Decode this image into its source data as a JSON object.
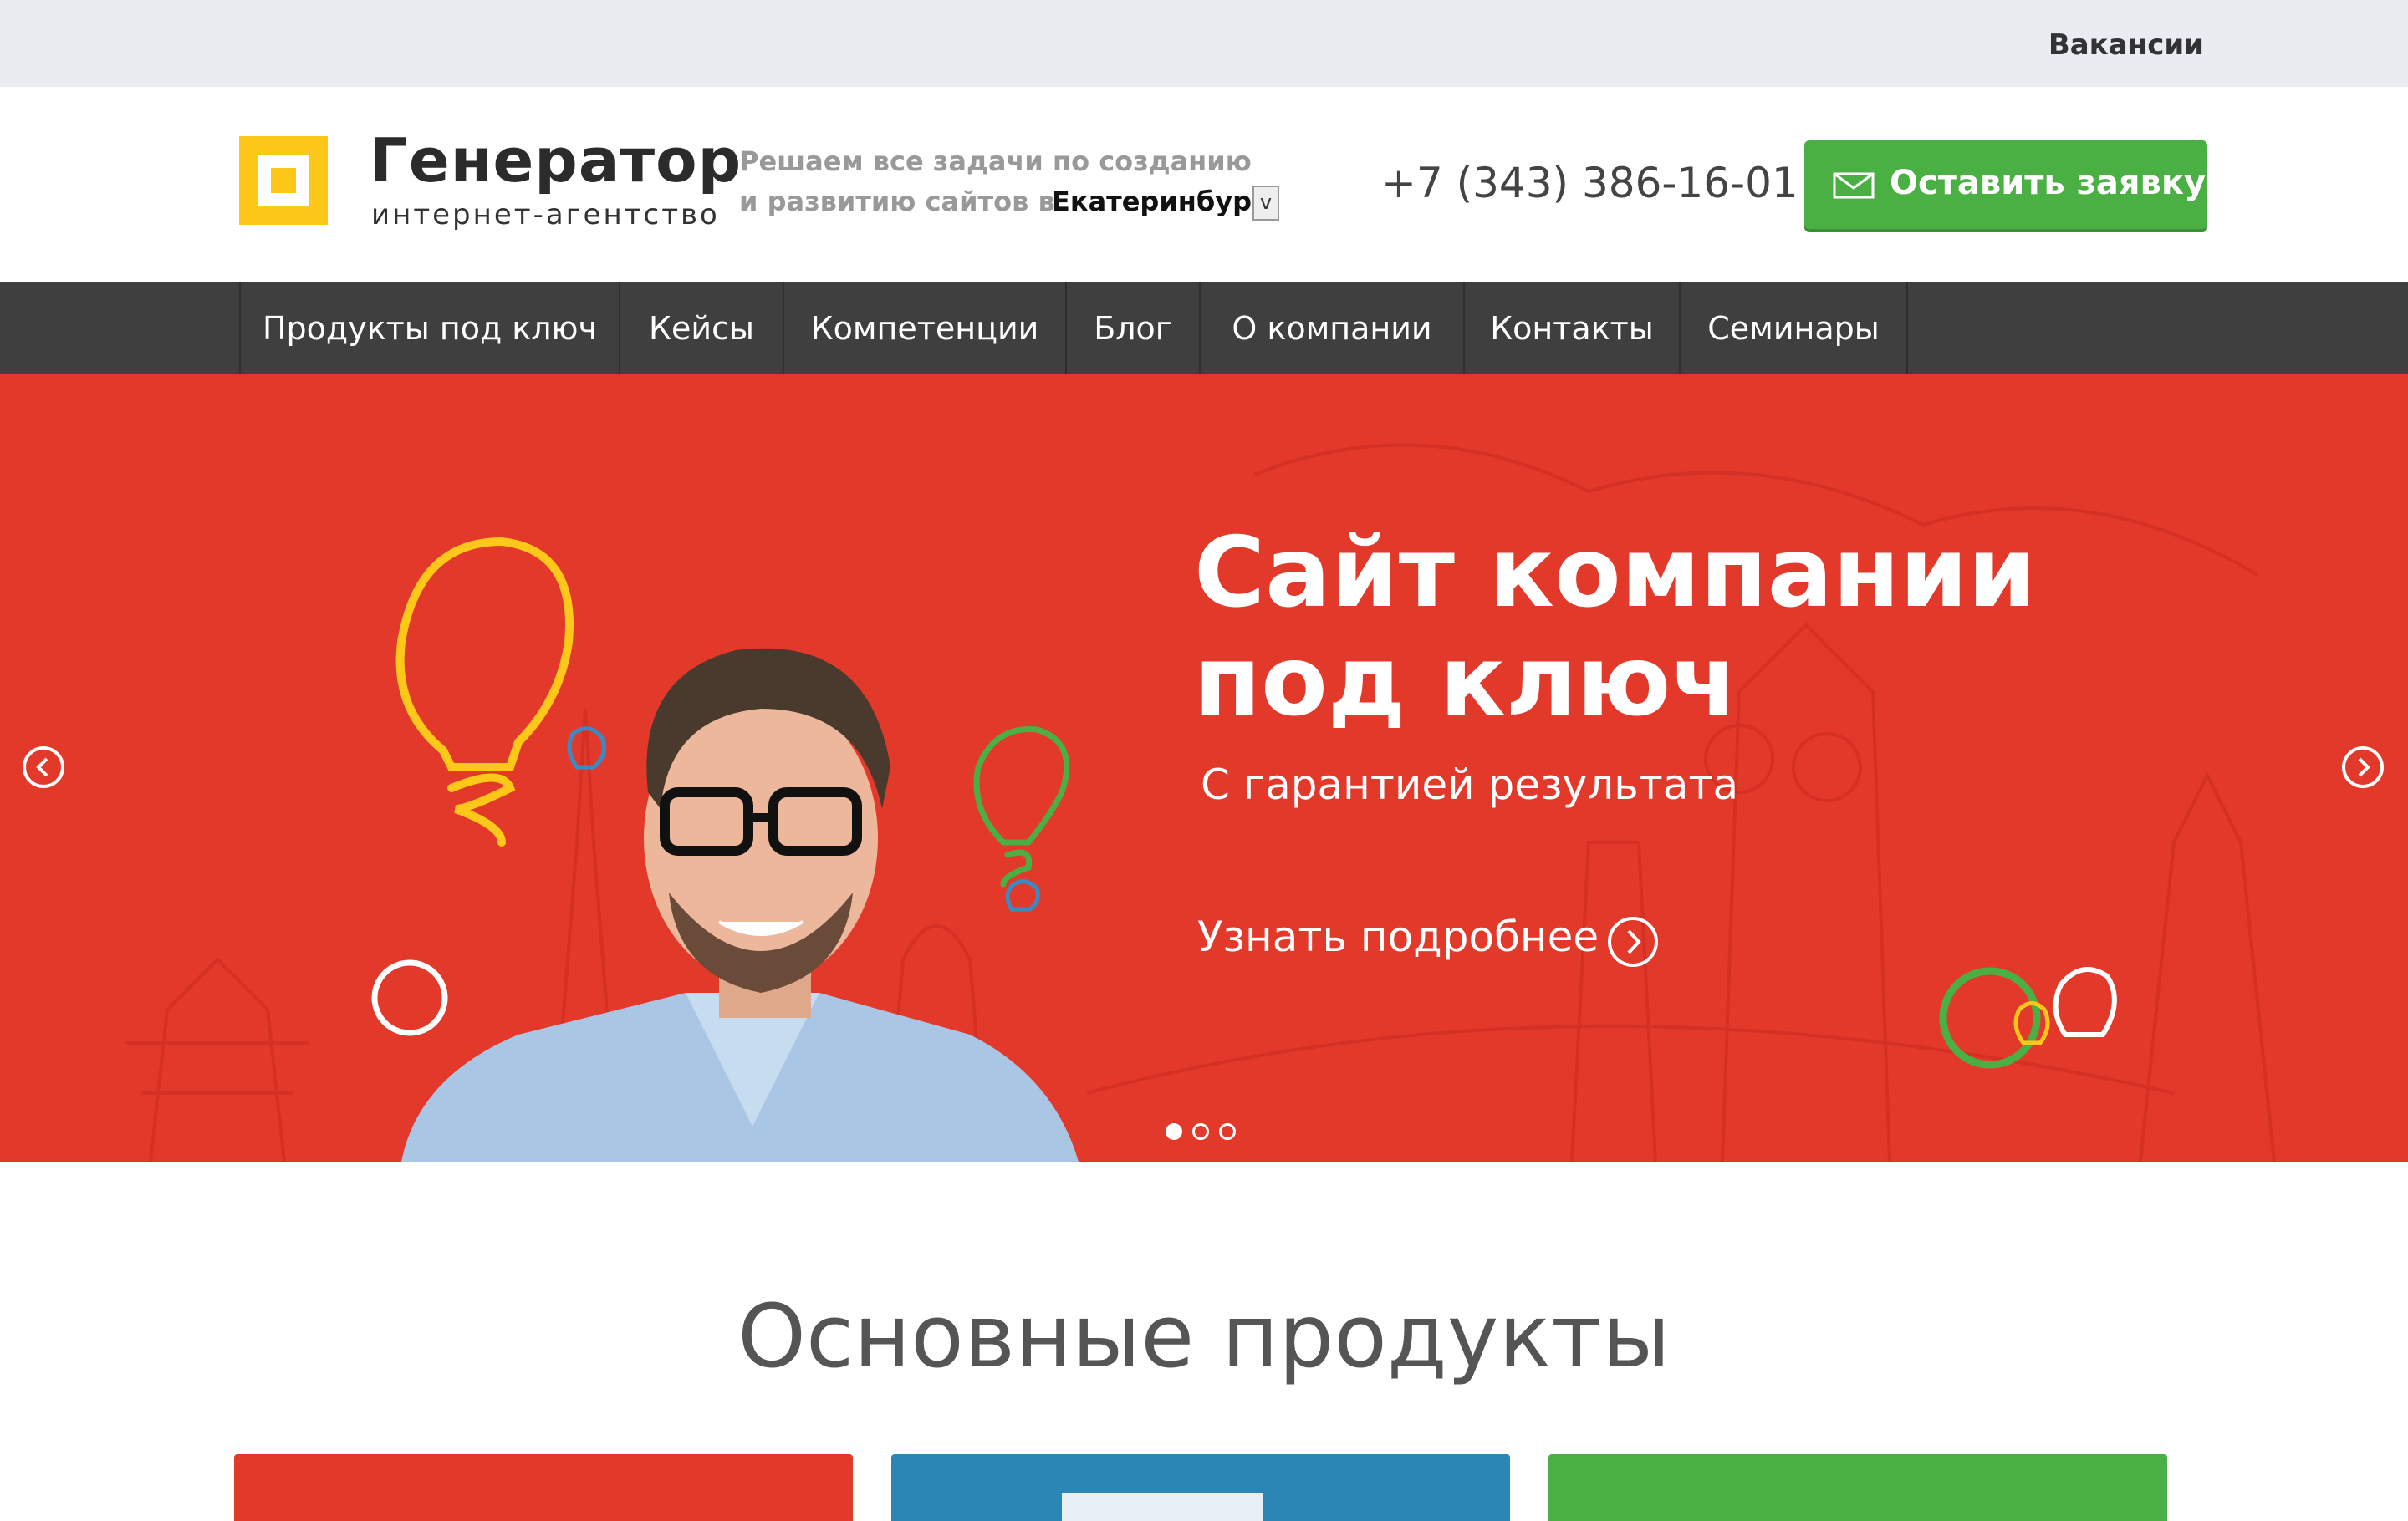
{
  "topbar": {
    "vacancies": "Вакансии"
  },
  "header": {
    "logo_title": "Генератор",
    "logo_subtitle": "интернет-агентство",
    "tagline_line1": "Решаем все задачи по созданию",
    "tagline_line2": "и развитию сайтов в",
    "city": "Екатеринбург",
    "city_dropdown_glyph": "v",
    "phone": "+7 (343) 386-16-01",
    "cta_label": "Оставить заявку",
    "cta_icon": "mail-icon"
  },
  "nav": {
    "items": [
      {
        "label": "Продукты под ключ"
      },
      {
        "label": "Кейсы"
      },
      {
        "label": "Компетенции"
      },
      {
        "label": "Блог"
      },
      {
        "label": "О компании"
      },
      {
        "label": "Контакты"
      },
      {
        "label": "Семинары"
      }
    ]
  },
  "hero": {
    "title_line1": "Сайт компании",
    "title_line2": "под ключ",
    "subtitle": "С гарантией результата",
    "more_link": "Узнать подробнее",
    "slides_total": 3,
    "active_slide": 1,
    "prev_icon": "chevron-left-icon",
    "next_icon": "chevron-right-icon"
  },
  "products": {
    "title": "Основные продукты",
    "cards": [
      {
        "color": "#e2392b"
      },
      {
        "color": "#2b86b6"
      },
      {
        "color": "#4ab043"
      }
    ]
  },
  "colors": {
    "accent_yellow": "#fec81b",
    "cta_green": "#4ab043",
    "nav_bg": "#3f3f3f",
    "hero_red": "#e2392b"
  }
}
